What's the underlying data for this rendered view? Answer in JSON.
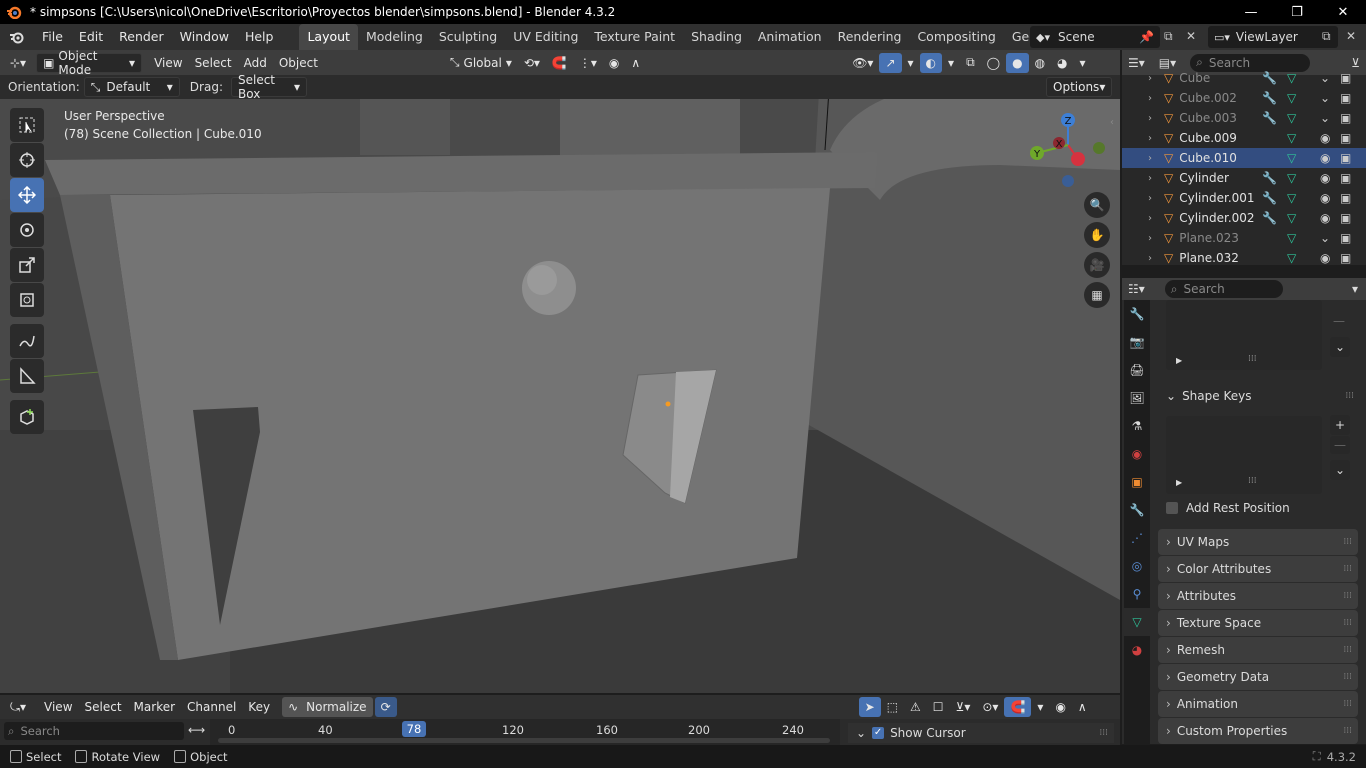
{
  "window": {
    "title": "* simpsons [C:\\Users\\nicol\\OneDrive\\Escritorio\\Proyectos blender\\simpsons.blend] - Blender 4.3.2"
  },
  "menu": [
    "File",
    "Edit",
    "Render",
    "Window",
    "Help"
  ],
  "workspaces": [
    "Layout",
    "Modeling",
    "Sculpting",
    "UV Editing",
    "Texture Paint",
    "Shading",
    "Animation",
    "Rendering",
    "Compositing",
    "Geometry Node"
  ],
  "scene": {
    "name": "Scene",
    "viewlayer": "ViewLayer"
  },
  "viewport_header": {
    "mode": "Object Mode",
    "menus": [
      "View",
      "Select",
      "Add",
      "Object"
    ],
    "transform": "Global"
  },
  "tool_settings": {
    "orientation_label": "Orientation:",
    "orientation_value": "Default",
    "drag_label": "Drag:",
    "drag_value": "Select Box",
    "options": "Options"
  },
  "viewport": {
    "perspective": "User Perspective",
    "collection": "(78) Scene Collection | Cube.010"
  },
  "gizmo": {
    "z": "Z",
    "y": "Y",
    "x": "X"
  },
  "outliner": {
    "search_placeholder": "Search",
    "items": [
      {
        "name": "Cube",
        "dim": true
      },
      {
        "name": "Cube.002",
        "dim": true
      },
      {
        "name": "Cube.003",
        "dim": true
      },
      {
        "name": "Cube.009",
        "dim": false
      },
      {
        "name": "Cube.010",
        "dim": false
      },
      {
        "name": "Cylinder",
        "dim": false
      },
      {
        "name": "Cylinder.001",
        "dim": false
      },
      {
        "name": "Cylinder.002",
        "dim": false
      },
      {
        "name": "Plane.023",
        "dim": true
      },
      {
        "name": "Plane.032",
        "dim": false
      }
    ]
  },
  "properties": {
    "search_placeholder": "Search",
    "shape_keys": "Shape Keys",
    "add_rest_position": "Add Rest Position",
    "panels": [
      "UV Maps",
      "Color Attributes",
      "Attributes",
      "Texture Space",
      "Remesh",
      "Geometry Data",
      "Animation",
      "Custom Properties"
    ]
  },
  "timeline": {
    "menus": [
      "View",
      "Select",
      "Marker",
      "Channel",
      "Key"
    ],
    "normalize": "Normalize",
    "search_placeholder": "Search",
    "current_frame": "78",
    "ticks": [
      "0",
      "40",
      "120",
      "160",
      "200",
      "240"
    ],
    "show_cursor": "Show Cursor"
  },
  "status": {
    "select": "Select",
    "rotate": "Rotate View",
    "object": "Object",
    "version": "4.3.2"
  }
}
